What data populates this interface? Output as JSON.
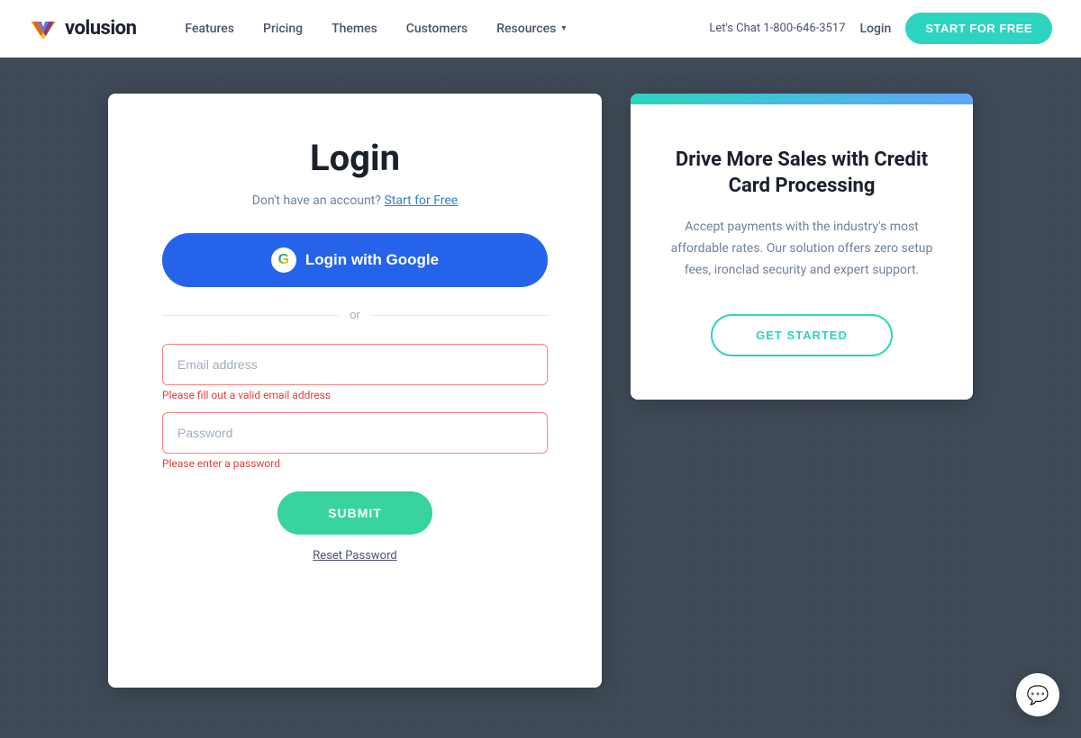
{
  "nav": {
    "logo_text": "volusion",
    "links": [
      {
        "label": "Features",
        "id": "features"
      },
      {
        "label": "Pricing",
        "id": "pricing"
      },
      {
        "label": "Themes",
        "id": "themes"
      },
      {
        "label": "Customers",
        "id": "customers"
      },
      {
        "label": "Resources",
        "id": "resources",
        "has_chevron": true
      }
    ],
    "chat_text": "Let's Chat  1-800-646-3517",
    "login_label": "Login",
    "cta_label": "START FOR FREE"
  },
  "login": {
    "title": "Login",
    "subtitle_text": "Don't have an account?",
    "start_free_link": "Start for Free",
    "google_btn_label": "Login with Google",
    "divider_text": "or",
    "email_placeholder": "Email address",
    "email_error": "Please fill out a valid email address",
    "password_placeholder": "Password",
    "password_error": "Please enter a password",
    "submit_label": "SUBMIT",
    "reset_label": "Reset Password"
  },
  "promo": {
    "title": "Drive More Sales with Credit Card Processing",
    "description": "Accept payments with the industry's most affordable rates. Our solution offers zero setup fees, ironclad security and expert support.",
    "cta_label": "GET STARTED"
  },
  "chat": {
    "icon": "💬"
  }
}
